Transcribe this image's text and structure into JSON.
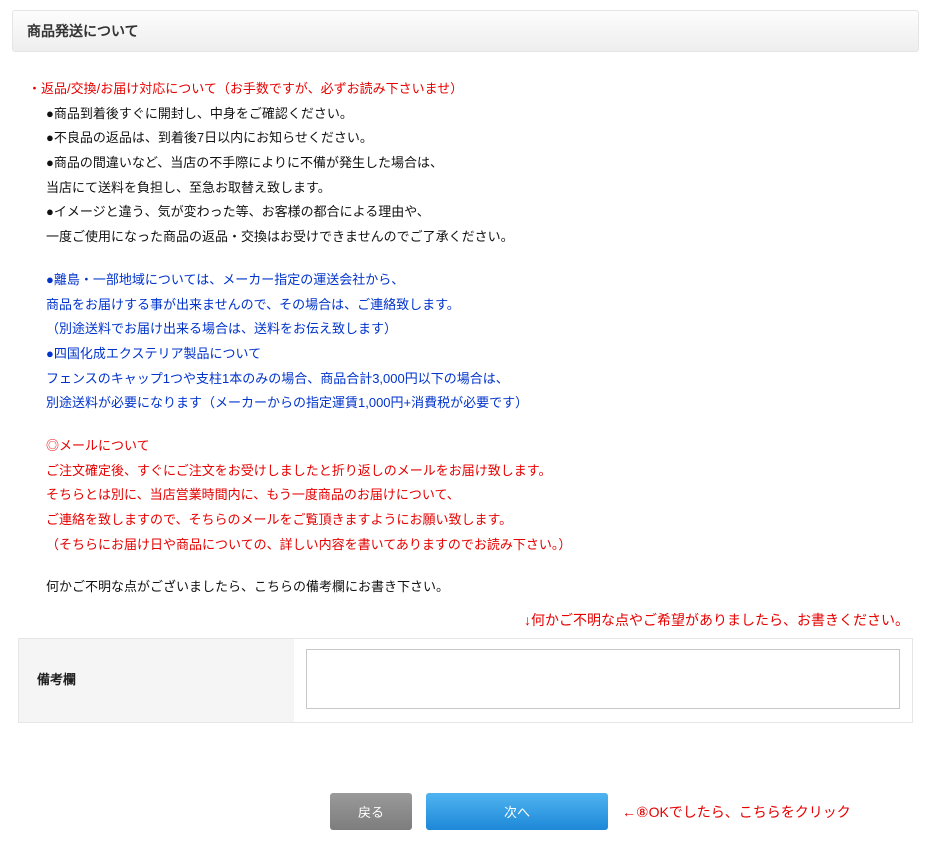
{
  "title": "商品発送について",
  "lines": [
    {
      "cls": "red",
      "indent": false,
      "text": "・返品/交換/お届け対応について（お手数ですが、必ずお読み下さいませ）"
    },
    {
      "cls": "black",
      "indent": true,
      "text": "●商品到着後すぐに開封し、中身をご確認ください。"
    },
    {
      "cls": "black",
      "indent": true,
      "text": "●不良品の返品は、到着後7日以内にお知らせください。"
    },
    {
      "cls": "black",
      "indent": true,
      "text": "●商品の間違いなど、当店の不手際によりに不備が発生した場合は、"
    },
    {
      "cls": "black",
      "indent": true,
      "text": "当店にて送料を負担し、至急お取替え致します。"
    },
    {
      "cls": "black",
      "indent": true,
      "text": "●イメージと違う、気が変わった等、お客様の都合による理由や、"
    },
    {
      "cls": "black",
      "indent": true,
      "text": "一度ご使用になった商品の返品・交換はお受けできませんのでご了承ください。"
    },
    {
      "cls": "spacer",
      "indent": false,
      "text": ""
    },
    {
      "cls": "blue",
      "indent": true,
      "text": "●離島・一部地域については、メーカー指定の運送会社から、"
    },
    {
      "cls": "blue",
      "indent": true,
      "text": "商品をお届けする事が出来ませんので、その場合は、ご連絡致します。"
    },
    {
      "cls": "blue",
      "indent": true,
      "text": "（別途送料でお届け出来る場合は、送料をお伝え致します）"
    },
    {
      "cls": "blue",
      "indent": true,
      "text": "●四国化成エクステリア製品について"
    },
    {
      "cls": "blue",
      "indent": true,
      "text": "フェンスのキャップ1つや支柱1本のみの場合、商品合計3,000円以下の場合は、"
    },
    {
      "cls": "blue",
      "indent": true,
      "text": "別途送料が必要になります（メーカーからの指定運賃1,000円+消費税が必要です）"
    },
    {
      "cls": "spacer",
      "indent": false,
      "text": ""
    },
    {
      "cls": "red",
      "indent": true,
      "text": "◎メールについて"
    },
    {
      "cls": "red",
      "indent": true,
      "text": "ご注文確定後、すぐにご注文をお受けしましたと折り返しのメールをお届け致します。"
    },
    {
      "cls": "red",
      "indent": true,
      "text": "そちらとは別に、当店営業時間内に、もう一度商品のお届けについて、"
    },
    {
      "cls": "red",
      "indent": true,
      "text": "ご連絡を致しますので、そちらのメールをご覧頂きますようにお願い致します。"
    },
    {
      "cls": "red",
      "indent": true,
      "text": "（そちらにお届け日や商品についての、詳しい内容を書いてありますのでお読み下さい。）"
    },
    {
      "cls": "spacer",
      "indent": false,
      "text": ""
    },
    {
      "cls": "black",
      "indent": true,
      "text": "何かご不明な点がございましたら、こちらの備考欄にお書き下さい。"
    }
  ],
  "annotation_top": "↓何かご不明な点やご希望がありましたら、お書きください。",
  "notes_label": "備考欄",
  "buttons": {
    "back": "戻る",
    "next": "次へ"
  },
  "annotation_side": "←⑧OKでしたら、こちらをクリック"
}
